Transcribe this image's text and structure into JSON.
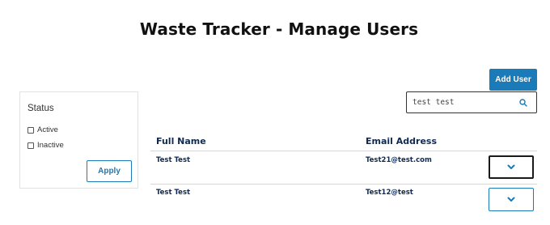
{
  "header": {
    "title": "Waste Tracker - Manage Users"
  },
  "toolbar": {
    "add_user_label": "Add User"
  },
  "search": {
    "value": "test test",
    "icon": "search-icon"
  },
  "filter": {
    "title": "Status",
    "options": [
      {
        "label": "Active",
        "checked": false
      },
      {
        "label": "Inactive",
        "checked": false
      }
    ],
    "apply_label": "Apply"
  },
  "table": {
    "columns": [
      "Full Name",
      "Email Address"
    ],
    "rows": [
      {
        "full_name": "Test Test",
        "email": "Test21@test.com",
        "toggle_icon": "chevron-down-icon"
      },
      {
        "full_name": "Test Test",
        "email": "Test12@test",
        "toggle_icon": "chevron-down-icon"
      }
    ]
  },
  "colors": {
    "accent": "#1b7ab8",
    "text_dark": "#0f2a52",
    "border": "#d8d8d8"
  }
}
